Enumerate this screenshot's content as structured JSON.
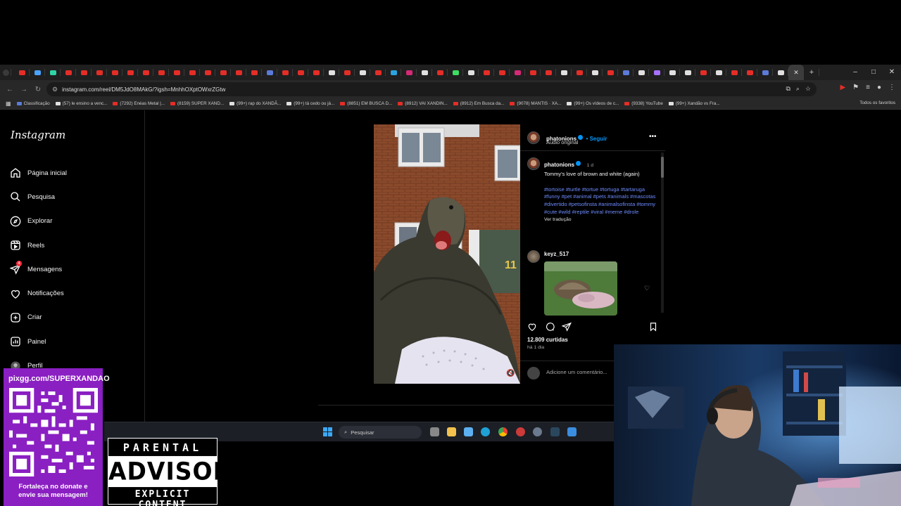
{
  "browser": {
    "tabs": {
      "favicon_colors": [
        "#e52d27",
        "#4aa3ff",
        "#2fd3a6",
        "#e52d27",
        "#e52d27",
        "#e52d27",
        "#e52d27",
        "#e52d27",
        "#e52d27",
        "#e52d27",
        "#e52d27",
        "#e52d27",
        "#e52d27",
        "#e52d27",
        "#e52d27",
        "#e52d27",
        "#5b7bd8",
        "#e52d27",
        "#e52d27",
        "#e52d27",
        "#e0e0e0",
        "#e52d27",
        "#e0e0e0",
        "#e52d27",
        "#2aa4e0",
        "#d62976",
        "#e0e0e0",
        "#e52d27",
        "#3ddc63",
        "#e0e0e0",
        "#e52d27",
        "#e52d27",
        "#d62976",
        "#e52d27",
        "#e52d27",
        "#e0e0e0",
        "#e52d27",
        "#e0e0e0",
        "#e52d27",
        "#5b7bd8",
        "#e0e0e0",
        "#a970ff",
        "#e0e0e0",
        "#e0e0e0",
        "#e52d27",
        "#e0e0e0",
        "#e52d27",
        "#e52d27",
        "#5b7bd8",
        "#e0e0e0"
      ],
      "close_glyph": "✕",
      "new_tab_glyph": "+"
    },
    "window_controls": [
      "–",
      "□",
      "✕"
    ],
    "url": "instagram.com/reel/DM5JdO8MAkG/?igsh=MnhhOXptOWxrZGtw",
    "bookmarks": [
      {
        "label": "Classificação",
        "color": "#5b7bd8"
      },
      {
        "label": "(57) le ensino a venc...",
        "color": "#e0e0e0"
      },
      {
        "label": "(7292) Enéas Metal |...",
        "color": "#e52d27"
      },
      {
        "label": "(8159) SUPER XAND...",
        "color": "#e52d27"
      },
      {
        "label": "(99+) rap do XANDÃ...",
        "color": "#e0e0e0"
      },
      {
        "label": "(99+) tá cedo ou já...",
        "color": "#e0e0e0"
      },
      {
        "label": "(8851) EM BUSCA D...",
        "color": "#e52d27"
      },
      {
        "label": "(8912) VAI XANDIN...",
        "color": "#e52d27"
      },
      {
        "label": "(8912) Em Busca da...",
        "color": "#e52d27"
      },
      {
        "label": "(9078) MANTIS · XA...",
        "color": "#e52d27"
      },
      {
        "label": "(99+) Os vídeos de c...",
        "color": "#e0e0e0"
      },
      {
        "label": "(9338) YouTube",
        "color": "#e52d27"
      },
      {
        "label": "(99+) Xandão vs Fra...",
        "color": "#e0e0e0"
      }
    ],
    "bookmarks_all": "Todos os favoritos"
  },
  "instagram": {
    "logo": "Instagram",
    "nav": [
      {
        "label": "Página inicial",
        "icon": "home-icon"
      },
      {
        "label": "Pesquisa",
        "icon": "search-icon"
      },
      {
        "label": "Explorar",
        "icon": "compass-icon"
      },
      {
        "label": "Reels",
        "icon": "reels-icon"
      },
      {
        "label": "Mensagens",
        "icon": "messenger-icon"
      },
      {
        "label": "Notificações",
        "icon": "heart-icon"
      },
      {
        "label": "Criar",
        "icon": "plus-square-icon"
      },
      {
        "label": "Painel",
        "icon": "dashboard-icon"
      },
      {
        "label": "Perfil",
        "icon": "profile-icon"
      }
    ],
    "messages_badge": "4",
    "post": {
      "username": "phatonions",
      "follow": "• Seguir",
      "audio": "Áudio original",
      "caption_user": "phatonions",
      "caption_time": "1 d",
      "caption": "Tommy's love of brown and white (again)",
      "hashtags": "#tortoise #turtle #tortue #tortuga #tartaruga #funny #pet #animal #pets #animals #mascotas #divertido #petsofinsta #animalsofinsta #tommy #cute #wild #reptile #viral #meme #drole",
      "see_translation": "Ver tradução",
      "comment_user": "keyz_517",
      "likes": "12.809 curtidas",
      "posted": "há 1 dia",
      "add_comment": "Adicione um comentário..."
    }
  },
  "taskbar": {
    "search_placeholder": "Pesquisar"
  },
  "overlays": {
    "pix_url": "pixgg.com/SUPERXANDAO",
    "pix_footer_1": "Fortaleça no donate e",
    "pix_footer_2": "envie sua mensagem!",
    "advisory_top": "PARENTAL",
    "advisory_mid": "ADVISORY",
    "advisory_bot": "EXPLICIT CONTENT"
  }
}
